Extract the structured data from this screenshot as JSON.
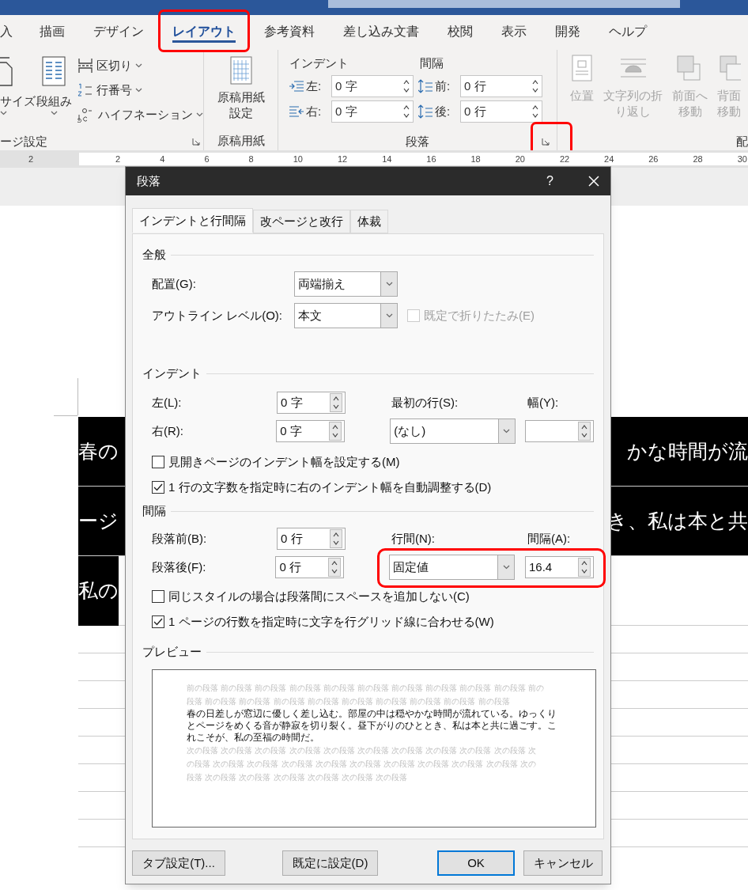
{
  "ribbon_tabs": [
    {
      "label": "入",
      "selected": false,
      "highlighted": false
    },
    {
      "label": "描画",
      "selected": false,
      "highlighted": false
    },
    {
      "label": "デザイン",
      "selected": false,
      "highlighted": false
    },
    {
      "label": "レイアウト",
      "selected": true,
      "highlighted": true
    },
    {
      "label": "参考資料",
      "selected": false,
      "highlighted": false
    },
    {
      "label": "差し込み文書",
      "selected": false,
      "highlighted": false
    },
    {
      "label": "校閲",
      "selected": false,
      "highlighted": false
    },
    {
      "label": "表示",
      "selected": false,
      "highlighted": false
    },
    {
      "label": "開発",
      "selected": false,
      "highlighted": false
    },
    {
      "label": "ヘルプ",
      "selected": false,
      "highlighted": false
    }
  ],
  "ribbon": {
    "page_setup": {
      "big_buttons": [
        {
          "label": "サイズ"
        },
        {
          "label": "段組み"
        }
      ],
      "small_buttons": [
        {
          "label": "区切り"
        },
        {
          "label": "行番号"
        },
        {
          "label": "ハイフネーション"
        }
      ],
      "group_label": "ージ設定"
    },
    "manuscript": {
      "button_lines": [
        "原稿用紙",
        "設定"
      ],
      "group_label": "原稿用紙"
    },
    "paragraph": {
      "indent_heading": "インデント",
      "spacing_heading": "間隔",
      "fields": [
        {
          "label": "左:",
          "value": "0 字"
        },
        {
          "label": "右:",
          "value": "0 字"
        },
        {
          "label": "前:",
          "value": "0 行"
        },
        {
          "label": "後:",
          "value": "0 行"
        }
      ],
      "group_label": "段落",
      "launcher_highlighted": true
    },
    "arrange": {
      "disabled": true,
      "buttons": [
        {
          "lines": [
            "位置"
          ]
        },
        {
          "lines": [
            "文字列の折",
            "り返し"
          ]
        },
        {
          "lines": [
            "前面へ",
            "移動"
          ]
        },
        {
          "lines": [
            "背面",
            "移動"
          ]
        }
      ],
      "group_label": "配"
    }
  },
  "ruler": {
    "labels": [
      "2",
      "2",
      "4",
      "6",
      "8",
      "10",
      "12",
      "14",
      "16",
      "18",
      "20",
      "22",
      "24",
      "26",
      "28",
      "30"
    ]
  },
  "document": {
    "lines": [
      {
        "left": "春の",
        "right": "かな時間が流"
      },
      {
        "left": "ージ",
        "right": "き、私は本と共"
      },
      {
        "left": "私の"
      }
    ]
  },
  "dialog": {
    "title": "段落",
    "help": "?",
    "tabs": [
      {
        "label": "インデントと行間隔",
        "selected": true
      },
      {
        "label": "改ページと改行",
        "selected": false
      },
      {
        "label": "体裁",
        "selected": false
      }
    ],
    "general": {
      "heading": "全般",
      "alignment": {
        "label": "配置(G):",
        "value": "両端揃え"
      },
      "outline": {
        "label": "アウトライン レベル(O):",
        "value": "本文"
      },
      "collapse": {
        "label": "既定で折りたたみ(E)",
        "checked": false,
        "disabled": true
      }
    },
    "indent": {
      "heading": "インデント",
      "left": {
        "label": "左(L):",
        "value": "0 字"
      },
      "right": {
        "label": "右(R):",
        "value": "0 字"
      },
      "first_line": {
        "label": "最初の行(S):",
        "value": "(なし)"
      },
      "by": {
        "label": "幅(Y):"
      },
      "checks": [
        {
          "label": "見開きページのインデント幅を設定する(M)",
          "checked": false
        },
        {
          "label": "1 行の文字数を指定時に右のインデント幅を自動調整する(D)",
          "checked": true
        }
      ]
    },
    "spacing": {
      "heading": "間隔",
      "before": {
        "label": "段落前(B):",
        "value": "0 行"
      },
      "after": {
        "label": "段落後(F):",
        "value": "0 行"
      },
      "line_spacing": {
        "label": "行間(N):",
        "value": "固定値"
      },
      "at": {
        "label": "間隔(A):",
        "value": "16.4"
      },
      "highlighted": true,
      "checks": [
        {
          "label": "同じスタイルの場合は段落間にスペースを追加しない(C)",
          "checked": false
        },
        {
          "label": "1 ページの行数を指定時に文字を行グリッド線に合わせる(W)",
          "checked": true
        }
      ]
    },
    "preview": {
      "heading": "プレビュー",
      "before_text": "前の段落 前の段落 前の段落 前の段落 前の段落 前の段落 前の段落 前の段落 前の段落 前の段落 前の段落 前の段落 前の段落 前の段落 前の段落 前の段落 前の段落 前の段落 前の段落 前の段落",
      "sample_text": "春の日差しが窓辺に優しく差し込む。部屋の中は穏やかな時間が流れている。ゆっくりとページをめくる音が静寂を切り裂く。昼下がりのひととき、私は本と共に過ごす。これこそが、私の至福の時間だ。",
      "after_text": "次の段落 次の段落 次の段落 次の段落 次の段落 次の段落 次の段落 次の段落 次の段落 次の段落 次の段落 次の段落 次の段落 次の段落 次の段落 次の段落 次の段落 次の段落 次の段落 次の段落 次の段落 次の段落 次の段落 次の段落 次の段落 次の段落 次の段落"
    },
    "buttons": [
      {
        "label": "タブ設定(T)...",
        "default": false
      },
      {
        "label": "既定に設定(D)",
        "default": false
      },
      {
        "label": "OK",
        "default": true
      },
      {
        "label": "キャンセル",
        "default": false
      }
    ]
  }
}
